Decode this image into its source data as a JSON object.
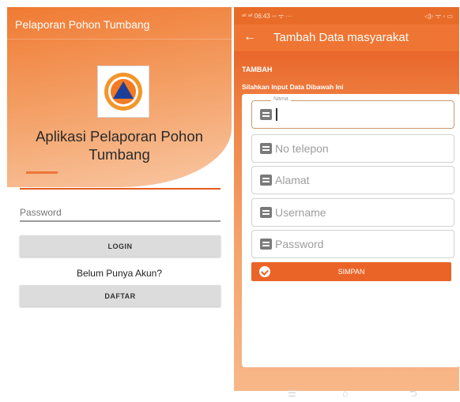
{
  "left_screen": {
    "title": "Pelaporan Pohon Tumbang",
    "app_name": "Aplikasi Pelaporan Pohon Tumbang",
    "password_placeholder": "Password",
    "login_label": "LOGIN",
    "register_prompt": "Belum Punya Akun?",
    "register_label": "DAFTAR",
    "logo_icon": "bnpb-triangle-logo"
  },
  "right_screen": {
    "status_bar": {
      "left": "ᵃⁱˡ ᵃⁱˡ 06:43 ◦◦ ᯤ ···",
      "right": "◁)◦ ᯤ ◦ ▭"
    },
    "app_bar": {
      "back_icon": "arrow-left-icon",
      "title": "Tambah Data masyarakat"
    },
    "section_label": "TAMBAH",
    "instruction": "Silahkan Input Data Dibawah Ini",
    "form": {
      "nama_label": "Nama",
      "nama_value": "",
      "phone_placeholder": "No telepon",
      "alamat_placeholder": "Alamat",
      "username_placeholder": "Username",
      "password_placeholder": "Password",
      "submit_label": "SIMPAN"
    },
    "nav_bar": {
      "menu_icon": "☰",
      "home_icon": "⌂",
      "back_icon": "⮌"
    }
  },
  "colors": {
    "accent_orange": "#ee7533",
    "button_orange": "#ea6427",
    "button_gray": "#dcdcdc"
  }
}
